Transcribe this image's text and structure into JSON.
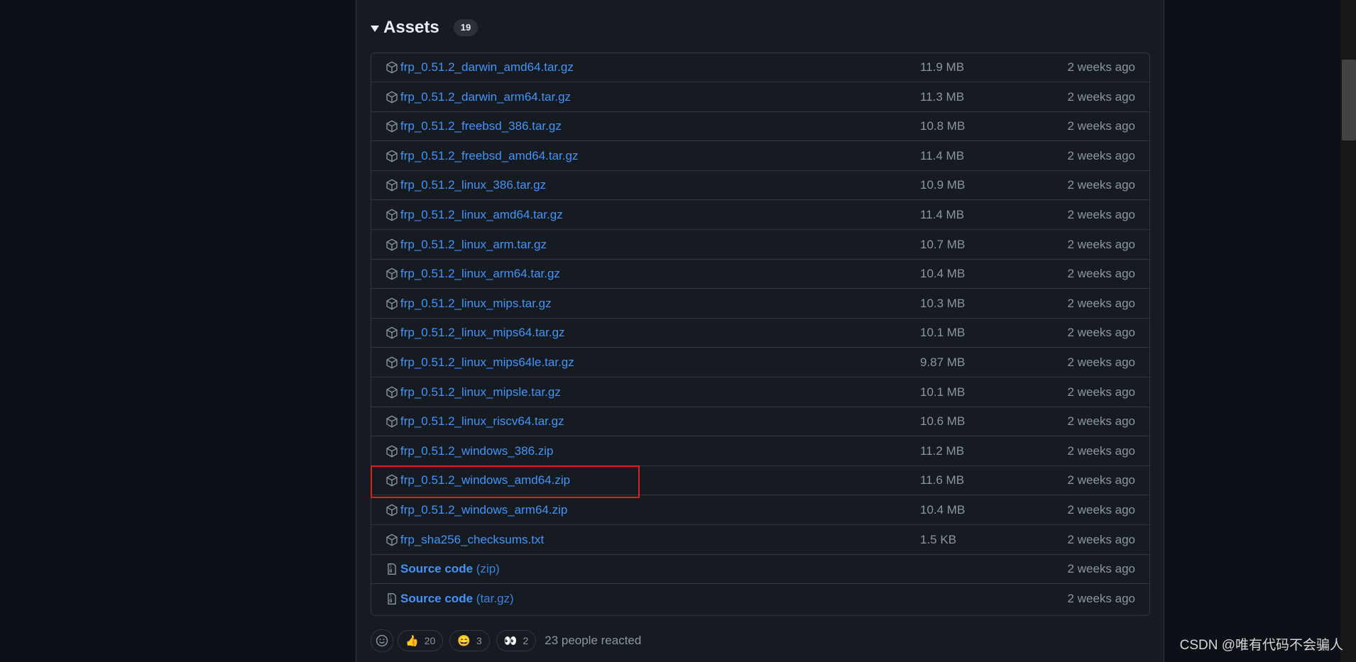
{
  "assets": {
    "title": "Assets",
    "count": "19",
    "rows": [
      {
        "name": "frp_0.51.2_darwin_amd64.tar.gz",
        "size": "11.9 MB",
        "date": "2 weeks ago"
      },
      {
        "name": "frp_0.51.2_darwin_arm64.tar.gz",
        "size": "11.3 MB",
        "date": "2 weeks ago"
      },
      {
        "name": "frp_0.51.2_freebsd_386.tar.gz",
        "size": "10.8 MB",
        "date": "2 weeks ago"
      },
      {
        "name": "frp_0.51.2_freebsd_amd64.tar.gz",
        "size": "11.4 MB",
        "date": "2 weeks ago"
      },
      {
        "name": "frp_0.51.2_linux_386.tar.gz",
        "size": "10.9 MB",
        "date": "2 weeks ago"
      },
      {
        "name": "frp_0.51.2_linux_amd64.tar.gz",
        "size": "11.4 MB",
        "date": "2 weeks ago"
      },
      {
        "name": "frp_0.51.2_linux_arm.tar.gz",
        "size": "10.7 MB",
        "date": "2 weeks ago"
      },
      {
        "name": "frp_0.51.2_linux_arm64.tar.gz",
        "size": "10.4 MB",
        "date": "2 weeks ago"
      },
      {
        "name": "frp_0.51.2_linux_mips.tar.gz",
        "size": "10.3 MB",
        "date": "2 weeks ago"
      },
      {
        "name": "frp_0.51.2_linux_mips64.tar.gz",
        "size": "10.1 MB",
        "date": "2 weeks ago"
      },
      {
        "name": "frp_0.51.2_linux_mips64le.tar.gz",
        "size": "9.87 MB",
        "date": "2 weeks ago"
      },
      {
        "name": "frp_0.51.2_linux_mipsle.tar.gz",
        "size": "10.1 MB",
        "date": "2 weeks ago"
      },
      {
        "name": "frp_0.51.2_linux_riscv64.tar.gz",
        "size": "10.6 MB",
        "date": "2 weeks ago"
      },
      {
        "name": "frp_0.51.2_windows_386.zip",
        "size": "11.2 MB",
        "date": "2 weeks ago"
      },
      {
        "name": "frp_0.51.2_windows_amd64.zip",
        "size": "11.6 MB",
        "date": "2 weeks ago"
      },
      {
        "name": "frp_0.51.2_windows_arm64.zip",
        "size": "10.4 MB",
        "date": "2 weeks ago"
      },
      {
        "name": "frp_sha256_checksums.txt",
        "size": "1.5 KB",
        "date": "2 weeks ago"
      }
    ],
    "source_rows": [
      {
        "name": "Source code",
        "format": "(zip)",
        "date": "2 weeks ago"
      },
      {
        "name": "Source code",
        "format": "(tar.gz)",
        "date": "2 weeks ago"
      }
    ],
    "highlighted_row": 14
  },
  "reactions": {
    "items": [
      {
        "emoji": "👍",
        "count": "20"
      },
      {
        "emoji": "😄",
        "count": "3"
      },
      {
        "emoji": "👀",
        "count": "2"
      }
    ],
    "summary": "23 people reacted"
  },
  "watermark": "CSDN @唯有代码不会骗人",
  "icons": {
    "asset": "package-icon",
    "source": "file-zip-icon",
    "picker": "smiley-icon"
  },
  "colors": {
    "link": "#4493f8",
    "muted": "#8d96a0",
    "highlight": "#e0201f"
  }
}
